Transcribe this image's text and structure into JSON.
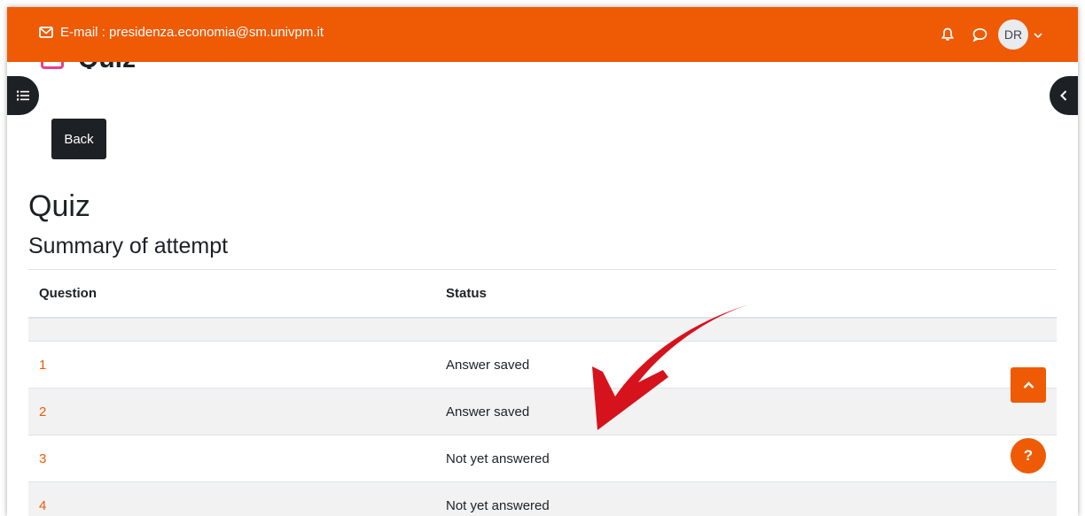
{
  "header": {
    "email": "E-mail : presidenza.economia@sm.univpm.it",
    "avatar_initials": "DR",
    "icons": [
      "envelope-icon",
      "bell-icon",
      "chat-icon",
      "chevron-down-icon"
    ]
  },
  "heading_peek": "Quiz",
  "back_label": "Back",
  "title": "Quiz",
  "subtitle": "Summary of attempt",
  "table": {
    "headers": [
      "Question",
      "Status"
    ],
    "rows": [
      {
        "question": "1",
        "status": "Answer saved"
      },
      {
        "question": "2",
        "status": "Answer saved"
      },
      {
        "question": "3",
        "status": "Not yet answered"
      },
      {
        "question": "4",
        "status": "Not yet answered"
      }
    ]
  },
  "help_label": "?",
  "colors": {
    "brand": "#ef5a04",
    "dark": "#1d2125",
    "annotation_arrow": "#d6131c"
  }
}
